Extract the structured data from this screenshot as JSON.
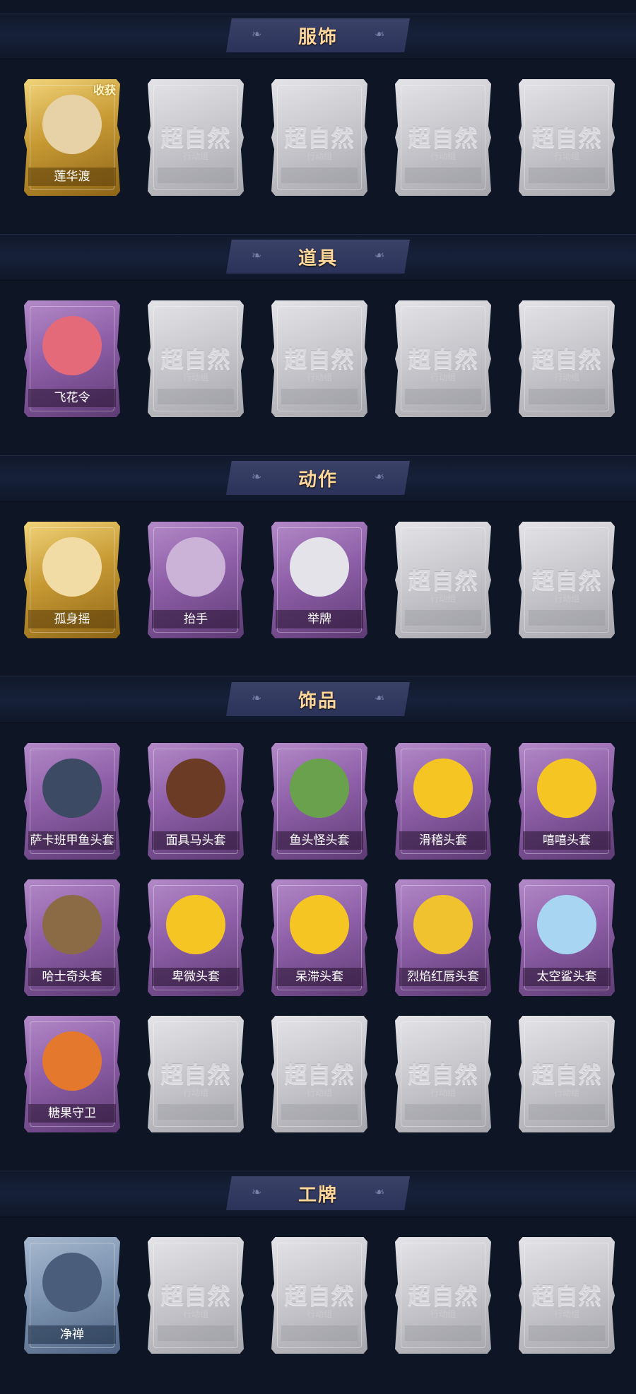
{
  "locked": {
    "mark": "超自然",
    "sub": "行动组"
  },
  "sections": [
    {
      "title": "服饰",
      "items": [
        {
          "name": "莲华渡",
          "tier": "gold",
          "badge": "收获",
          "icon": "costume-portrait-icon",
          "art": "#e7d2a8"
        }
      ]
    },
    {
      "title": "道具",
      "items": [
        {
          "name": "飞花令",
          "tier": "purple",
          "icon": "flower-bouquet-icon",
          "art": "#e46a7a"
        }
      ]
    },
    {
      "title": "动作",
      "items": [
        {
          "name": "孤身摇",
          "tier": "gold",
          "icon": "dance-pose-icon",
          "art": "#f0dca4"
        },
        {
          "name": "抬手",
          "tier": "purple",
          "icon": "raise-hand-icon",
          "art": "#cbb3d8"
        },
        {
          "name": "举牌",
          "tier": "purple",
          "icon": "hold-sign-icon",
          "art": "#e5e3ea"
        }
      ]
    },
    {
      "title": "饰品",
      "items": [
        {
          "name": "萨卡班甲鱼头套",
          "tier": "purple",
          "icon": "fish-head-icon",
          "art": "#3d4a63"
        },
        {
          "name": "面具马头套",
          "tier": "purple",
          "icon": "horse-head-icon",
          "art": "#6b3b25"
        },
        {
          "name": "鱼头怪头套",
          "tier": "purple",
          "icon": "fish-monster-head-icon",
          "art": "#6aa14c"
        },
        {
          "name": "滑稽头套",
          "tier": "purple",
          "icon": "funny-face-icon",
          "art": "#f5c524"
        },
        {
          "name": "嘻嘻头套",
          "tier": "purple",
          "icon": "grin-face-icon",
          "art": "#f5c524"
        },
        {
          "name": "哈士奇头套",
          "tier": "purple",
          "icon": "husky-head-icon",
          "art": "#8b6a46"
        },
        {
          "name": "卑微头套",
          "tier": "purple",
          "icon": "humble-face-icon",
          "art": "#f5c524"
        },
        {
          "name": "呆滞头套",
          "tier": "purple",
          "icon": "dazed-face-icon",
          "art": "#f5c524"
        },
        {
          "name": "烈焰红唇头套",
          "tier": "purple",
          "icon": "red-lips-head-icon",
          "art": "#f0c230"
        },
        {
          "name": "太空鲨头套",
          "tier": "purple",
          "icon": "space-shark-icon",
          "art": "#a8d6f2"
        },
        {
          "name": "糖果守卫",
          "tier": "purple",
          "icon": "pumpkin-guard-icon",
          "art": "#e4782c"
        }
      ]
    },
    {
      "title": "工牌",
      "items": [
        {
          "name": "净禅",
          "tier": "blue",
          "icon": "badge-silhouette-icon",
          "art": "#4a5e7c"
        }
      ]
    }
  ]
}
